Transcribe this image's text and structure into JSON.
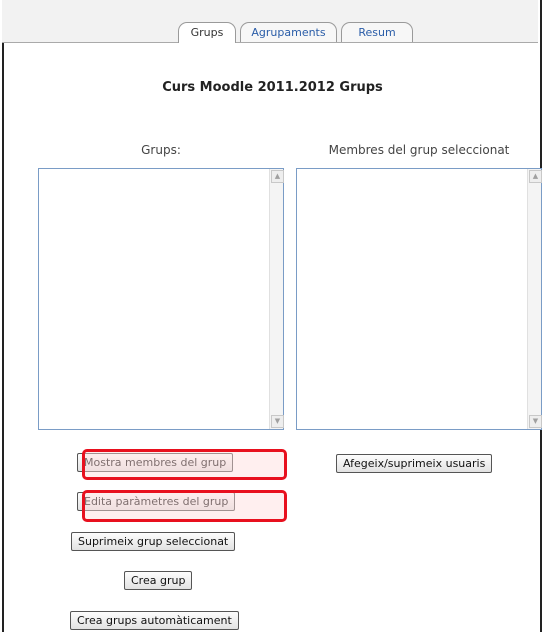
{
  "tabs": [
    {
      "label": "Grups",
      "active": true
    },
    {
      "label": "Agrupaments",
      "active": false
    },
    {
      "label": "Resum",
      "active": false
    }
  ],
  "page_title": "Curs Moodle 2011.2012 Grups",
  "groups_panel": {
    "label": "Grups:",
    "items": [],
    "buttons": {
      "show_members": "Mostra membres del grup",
      "edit_settings": "Edita paràmetres del grup",
      "delete_selected": "Suprimeix grup seleccionat",
      "create_group": "Crea grup",
      "auto_create": "Crea grups automàticament"
    }
  },
  "members_panel": {
    "label": "Membres del grup seleccionat",
    "items": [],
    "buttons": {
      "add_remove_users": "Afegeix/suprimeix usuaris"
    }
  },
  "colors": {
    "highlight": "#e8101e",
    "link": "#2a5da8",
    "listbox_border": "#7a9cc6"
  },
  "icons": {
    "scroll_up": "scroll-up-arrow-icon",
    "scroll_down": "scroll-down-arrow-icon"
  }
}
